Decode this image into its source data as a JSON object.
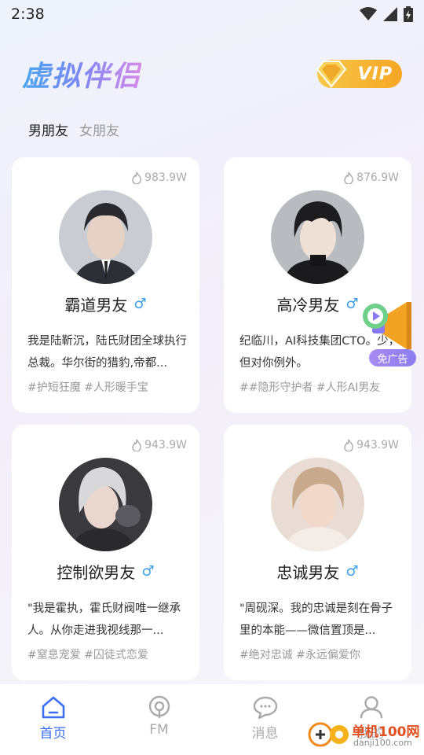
{
  "status": {
    "time": "2:38"
  },
  "header": {
    "title": "虚拟伴侣",
    "vip_label": "VIP"
  },
  "tabs": [
    {
      "label": "男朋友",
      "active": true
    },
    {
      "label": "女朋友",
      "active": false
    }
  ],
  "cards": [
    {
      "heat": "983.9W",
      "name": "霸道男友",
      "gender_icon": "male-icon",
      "desc": "我是陆靳沉，陆氏财团全球执行总裁。华尔街的猎豹,帝都...",
      "tags": "#护短狂魔 #人形暖手宝",
      "avatar": "avatar-dark-suit"
    },
    {
      "heat": "876.9W",
      "name": "高冷男友",
      "gender_icon": "male-icon",
      "desc": "纪临川，AI科技集团CTO。少，但对你例外。",
      "tags": "##隐形守护者 #人形AI男友",
      "avatar": "avatar-black-turtleneck"
    },
    {
      "heat": "943.9W",
      "name": "控制欲男友",
      "gender_icon": "male-icon",
      "desc": "\"我是霍执，霍氏财阀唯一继承人。从你走进我视线那一...",
      "tags": "#窒息宠爱 #囚徒式恋爱",
      "avatar": "avatar-silver-hair"
    },
    {
      "heat": "943.9W",
      "name": "忠诚男友",
      "gender_icon": "male-icon",
      "desc": "\"周砚深。我的忠诚是刻在骨子里的本能——微信置顶是...",
      "tags": "#绝对忠诚 #永远偏爱你",
      "avatar": "avatar-blonde"
    }
  ],
  "ad": {
    "label": "免广告"
  },
  "nav": [
    {
      "label": "首页",
      "icon": "home-icon",
      "active": true
    },
    {
      "label": "FM",
      "icon": "radio-icon",
      "active": false
    },
    {
      "label": "消息",
      "icon": "chat-icon",
      "active": false
    },
    {
      "label": "我的",
      "icon": "user-icon",
      "active": false
    }
  ],
  "watermark": {
    "text": "单机100网",
    "sub": "danji100.com"
  },
  "colors": {
    "accent": "#3b6ff0",
    "male": "#3a9fe8",
    "vip": "#f5a623"
  }
}
